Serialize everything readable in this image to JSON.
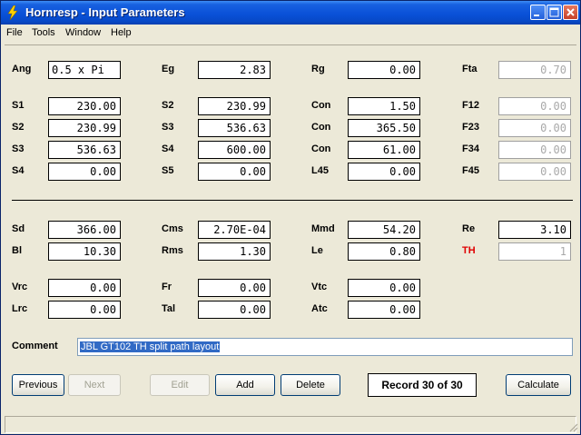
{
  "window": {
    "title": "Hornresp - Input Parameters"
  },
  "menu": [
    "File",
    "Tools",
    "Window",
    "Help"
  ],
  "rows_top": [
    [
      {
        "label": "Ang",
        "value": "0.5 x Pi"
      },
      {
        "label": "Eg",
        "value": "2.83"
      },
      {
        "label": "Rg",
        "value": "0.00"
      },
      {
        "label": "Fta",
        "value": "0.70",
        "disabled": true
      }
    ],
    [
      {
        "label": "S1",
        "value": "230.00"
      },
      {
        "label": "S2",
        "value": "230.99"
      },
      {
        "label": "Con",
        "value": "1.50"
      },
      {
        "label": "F12",
        "value": "0.00",
        "disabled": true
      }
    ],
    [
      {
        "label": "S2",
        "value": "230.99"
      },
      {
        "label": "S3",
        "value": "536.63"
      },
      {
        "label": "Con",
        "value": "365.50"
      },
      {
        "label": "F23",
        "value": "0.00",
        "disabled": true
      }
    ],
    [
      {
        "label": "S3",
        "value": "536.63"
      },
      {
        "label": "S4",
        "value": "600.00"
      },
      {
        "label": "Con",
        "value": "61.00"
      },
      {
        "label": "F34",
        "value": "0.00",
        "disabled": true
      }
    ],
    [
      {
        "label": "S4",
        "value": "0.00"
      },
      {
        "label": "S5",
        "value": "0.00"
      },
      {
        "label": "L45",
        "value": "0.00"
      },
      {
        "label": "F45",
        "value": "0.00",
        "disabled": true
      }
    ]
  ],
  "rows_bottom": [
    [
      {
        "label": "Sd",
        "value": "366.00"
      },
      {
        "label": "Cms",
        "value": "2.70E-04"
      },
      {
        "label": "Mmd",
        "value": "54.20"
      },
      {
        "label": "Re",
        "value": "3.10"
      }
    ],
    [
      {
        "label": "Bl",
        "value": "10.30"
      },
      {
        "label": "Rms",
        "value": "1.30"
      },
      {
        "label": "Le",
        "value": "0.80"
      },
      {
        "label": "TH",
        "value": "1",
        "disabled": true
      }
    ],
    [
      {
        "label": "Vrc",
        "value": "0.00"
      },
      {
        "label": "Fr",
        "value": "0.00"
      },
      {
        "label": "Vtc",
        "value": "0.00"
      }
    ],
    [
      {
        "label": "Lrc",
        "value": "0.00"
      },
      {
        "label": "Tal",
        "value": "0.00"
      },
      {
        "label": "Atc",
        "value": "0.00"
      }
    ]
  ],
  "comment": {
    "label": "Comment",
    "value": "JBL GT102 TH split path layout"
  },
  "buttons": {
    "previous": "Previous",
    "next": "Next",
    "edit": "Edit",
    "add": "Add",
    "delete": "Delete",
    "calculate": "Calculate"
  },
  "record": "Record 30 of 30",
  "colors": {
    "title_bar": "#0a51d8",
    "th_label": "#e00000",
    "selection": "#316ac5"
  },
  "icons": [
    "lightning-app-icon",
    "minimize-icon",
    "maximize-icon",
    "close-icon",
    "resize-grip-icon"
  ]
}
